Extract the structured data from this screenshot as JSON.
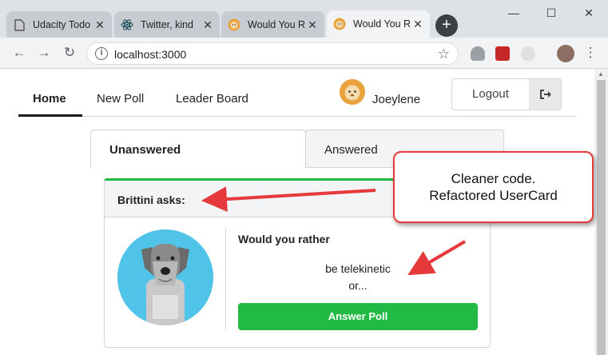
{
  "browser": {
    "tabs": [
      {
        "title": "Udacity Todo"
      },
      {
        "title": "Twitter, kind"
      },
      {
        "title": "Would You R"
      },
      {
        "title": "Would You R"
      }
    ],
    "address": "localhost:3000",
    "window_controls": {
      "minimize": "—",
      "maximize": "☐",
      "close": "✕"
    }
  },
  "app": {
    "nav": {
      "home": "Home",
      "new_poll": "New Poll",
      "leader_board": "Leader Board"
    },
    "user": {
      "name": "Joeylene"
    },
    "logout_label": "Logout",
    "poll_tabs": {
      "unanswered": "Unanswered",
      "answered": "Answered"
    },
    "card": {
      "author_heading": "Brittini asks:",
      "would_you_rather": "Would you rather",
      "option_one": "be telekinetic",
      "or_text": "or...",
      "answer_button": "Answer Poll"
    }
  },
  "annotation": {
    "line1": "Cleaner code.",
    "line2": "Refactored UserCard"
  },
  "colors": {
    "accent_green": "#21ba45",
    "annotation_red": "#e5393b",
    "avatar_blue": "#4fc3e8"
  }
}
